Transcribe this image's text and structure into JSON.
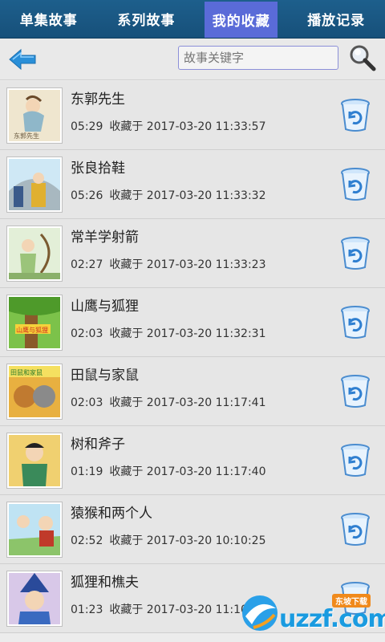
{
  "tabs": [
    {
      "label": "单集故事"
    },
    {
      "label": "系列故事"
    },
    {
      "label": "我的收藏"
    },
    {
      "label": "播放记录"
    }
  ],
  "active_tab": 2,
  "search": {
    "placeholder": "故事关键字"
  },
  "items": [
    {
      "title": "东郭先生",
      "duration": "05:29",
      "saved": "收藏于 2017-03-20 11:33:57",
      "thumb_label": "东郭先生"
    },
    {
      "title": "张良拾鞋",
      "duration": "05:26",
      "saved": "收藏于 2017-03-20 11:33:32"
    },
    {
      "title": "常羊学射箭",
      "duration": "02:27",
      "saved": "收藏于 2017-03-20 11:33:23"
    },
    {
      "title": "山鹰与狐狸",
      "duration": "02:03",
      "saved": "收藏于 2017-03-20 11:32:31",
      "thumb_label": "山鹰与狐狸"
    },
    {
      "title": "田鼠与家鼠",
      "duration": "02:03",
      "saved": "收藏于 2017-03-20 11:17:41",
      "thumb_label": "田鼠和家鼠"
    },
    {
      "title": "树和斧子",
      "duration": "01:19",
      "saved": "收藏于 2017-03-20 11:17:40"
    },
    {
      "title": "猿猴和两个人",
      "duration": "02:52",
      "saved": "收藏于 2017-03-20 10:10:25"
    },
    {
      "title": "狐狸和樵夫",
      "duration": "01:23",
      "saved": "收藏于 2017-03-20 11:10"
    }
  ],
  "watermark": {
    "text": "uzzf.com",
    "badge": "东坡下载"
  },
  "colors": {
    "tab_bg": "#1d5f8c",
    "tab_active": "#5a6bd8",
    "back_arrow": "#2a8fd8"
  },
  "icons": {
    "back": "back-arrow-icon",
    "search": "magnifier-icon",
    "delete": "trash-can-icon"
  }
}
